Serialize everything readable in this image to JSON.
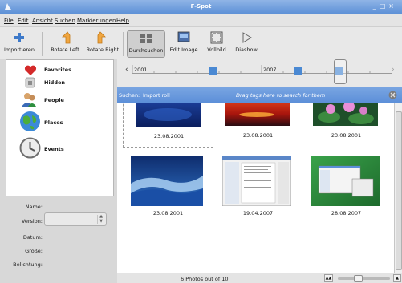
{
  "window": {
    "title": "F-Spot"
  },
  "menu": [
    "File",
    "Edit",
    "Ansicht",
    "Suchen",
    "Markierungen",
    "Help"
  ],
  "toolbar": {
    "import": "Importieren",
    "rotate_left": "Rotate Left",
    "rotate_right": "Rotate Right",
    "browse": "Durchsuchen",
    "edit_image": "Edit Image",
    "fullscreen": "Vollbild",
    "slideshow": "Diashow"
  },
  "sidebar": {
    "items": [
      {
        "label": "Favorites",
        "icon": "heart-icon"
      },
      {
        "label": "Hidden",
        "icon": "lock-icon"
      },
      {
        "label": "People",
        "icon": "people-icon"
      },
      {
        "label": "Places",
        "icon": "globe-icon"
      },
      {
        "label": "Events",
        "icon": "clock-icon"
      }
    ]
  },
  "properties": {
    "name_label": "Name:",
    "version_label": "Version:",
    "date_label": "Datum:",
    "size_label": "Größe:",
    "exposure_label": "Belichtung:"
  },
  "timeline": {
    "years": [
      "2001",
      "2007"
    ]
  },
  "search": {
    "label": "Suchen:",
    "tag": "Import roll",
    "hint": "Drag tags here to search for them"
  },
  "photos": [
    {
      "date": "23.08.2001",
      "kind": "blue"
    },
    {
      "date": "23.08.2001",
      "kind": "sunset"
    },
    {
      "date": "23.08.2001",
      "kind": "lotus"
    },
    {
      "date": "23.08.2001",
      "kind": "wave"
    },
    {
      "date": "19.04.2007",
      "kind": "screenshot-doc"
    },
    {
      "date": "28.08.2007",
      "kind": "screenshot-green"
    }
  ],
  "status": {
    "count_text": "6 Photos out of 10"
  },
  "colors": {
    "selection_blue": "#5b8ed8",
    "timeline_bar": "#4a89d3"
  }
}
